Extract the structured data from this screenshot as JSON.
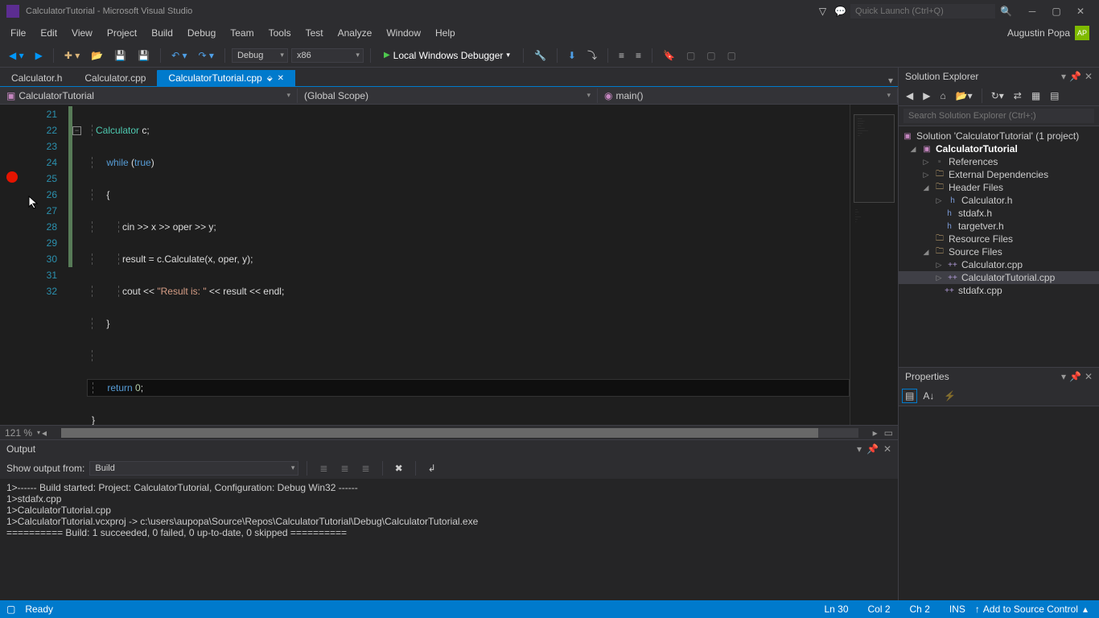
{
  "title": "CalculatorTutorial - Microsoft Visual Studio",
  "quicklaunch_placeholder": "Quick Launch (Ctrl+Q)",
  "menu": [
    "File",
    "Edit",
    "View",
    "Project",
    "Build",
    "Debug",
    "Team",
    "Tools",
    "Test",
    "Analyze",
    "Window",
    "Help"
  ],
  "user": "Augustin Popa",
  "toolbar": {
    "config": "Debug",
    "platform": "x86",
    "run": "Local Windows Debugger"
  },
  "tabs": [
    {
      "label": "Calculator.h",
      "active": false
    },
    {
      "label": "Calculator.cpp",
      "active": false
    },
    {
      "label": "CalculatorTutorial.cpp",
      "active": true
    }
  ],
  "nav": {
    "scope1": "CalculatorTutorial",
    "scope2": "(Global Scope)",
    "scope3": "main()"
  },
  "gutter": [
    "21",
    "22",
    "23",
    "24",
    "25",
    "26",
    "27",
    "28",
    "29",
    "30",
    "31",
    "32"
  ],
  "breakpoint_line": 25,
  "cursor_line": 26,
  "code": {
    "l21": "    Calculator c;",
    "l22a": "    ",
    "l22_while": "while",
    "l22b": " (",
    "l22_true": "true",
    "l22c": ")",
    "l23": "    {",
    "l24": "        cin >> x >> oper >> y;",
    "l25": "        result = c.Calculate(x, oper, y);",
    "l26a": "        cout << ",
    "l26_str": "\"Result is: \"",
    "l26b": " << result << endl;",
    "l27": "    }",
    "l28": "",
    "l29a": "    ",
    "l29_return": "return",
    "l29b": " ",
    "l29_zero": "0",
    "l29c": ";",
    "l30": "}"
  },
  "zoom": "121 %",
  "output": {
    "title": "Output",
    "from_label": "Show output from:",
    "from_value": "Build",
    "lines": [
      "1>------ Build started: Project: CalculatorTutorial, Configuration: Debug Win32 ------",
      "1>stdafx.cpp",
      "1>CalculatorTutorial.cpp",
      "1>CalculatorTutorial.vcxproj -> c:\\users\\aupopa\\Source\\Repos\\CalculatorTutorial\\Debug\\CalculatorTutorial.exe",
      "========== Build: 1 succeeded, 0 failed, 0 up-to-date, 0 skipped =========="
    ]
  },
  "solution": {
    "title": "Solution Explorer",
    "search_placeholder": "Search Solution Explorer (Ctrl+;)",
    "root": "Solution 'CalculatorTutorial' (1 project)",
    "project": "CalculatorTutorial",
    "refs": "References",
    "extdep": "External Dependencies",
    "headers": "Header Files",
    "header_items": [
      "Calculator.h",
      "stdafx.h",
      "targetver.h"
    ],
    "res": "Resource Files",
    "src": "Source Files",
    "src_items": [
      "Calculator.cpp",
      "CalculatorTutorial.cpp",
      "stdafx.cpp"
    ]
  },
  "properties": {
    "title": "Properties"
  },
  "status": {
    "ready": "Ready",
    "ln": "Ln 30",
    "col": "Col 2",
    "ch": "Ch 2",
    "ins": "INS",
    "source_control": "Add to Source Control"
  }
}
